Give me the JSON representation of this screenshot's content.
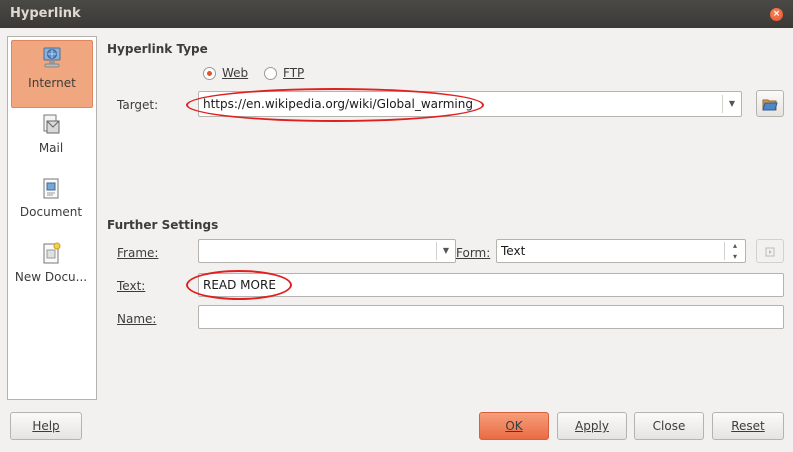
{
  "window": {
    "title": "Hyperlink",
    "close_glyph": "×"
  },
  "sidebar": {
    "items": [
      {
        "label": "Internet",
        "icon": "globe-computer-icon",
        "active": true
      },
      {
        "label": "Mail",
        "icon": "mail-icon",
        "active": false
      },
      {
        "label": "Document",
        "icon": "document-icon",
        "active": false
      },
      {
        "label": "New Docu...",
        "icon": "new-document-icon",
        "active": false
      }
    ]
  },
  "hyperlink_type": {
    "heading": "Hyperlink Type",
    "web_label": "Web",
    "ftp_label": "FTP",
    "selected": "Web",
    "target_label": "Target:",
    "target_value": "https://en.wikipedia.org/wiki/Global_warming"
  },
  "further_settings": {
    "heading": "Further Settings",
    "frame_label": "Frame:",
    "frame_value": "",
    "form_label": "Form:",
    "form_value": "Text",
    "text_label": "Text:",
    "text_value": "READ MORE",
    "name_label": "Name:",
    "name_value": ""
  },
  "buttons": {
    "help": "Help",
    "ok": "OK",
    "apply": "Apply",
    "close": "Close",
    "reset": "Reset"
  },
  "colors": {
    "accent": "#e4542a",
    "annotation": "#e02020",
    "titlebar": "#3b3a36"
  }
}
